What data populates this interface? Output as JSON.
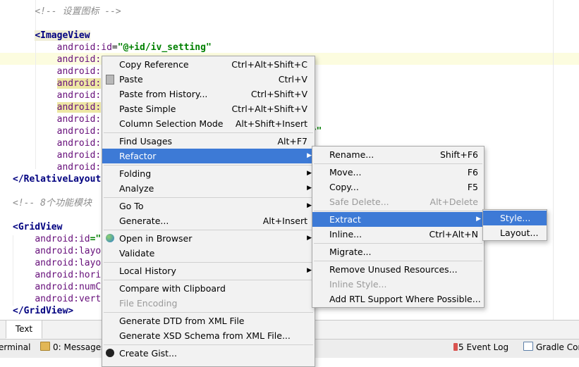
{
  "editor": {
    "lines": [
      {
        "indent": "    ",
        "parts": [
          {
            "t": "<!-- 设置图标 -->",
            "c": "c-comment"
          }
        ]
      },
      {
        "indent": "",
        "parts": []
      },
      {
        "indent": "    ",
        "parts": [
          {
            "t": "<",
            "c": "c-tag-hl"
          },
          {
            "t": "ImageView",
            "c": "c-tag-hl"
          }
        ]
      },
      {
        "indent": "        ",
        "parts": [
          {
            "t": "android:",
            "c": "c-attr"
          },
          {
            "t": "id",
            "c": "c-attr"
          },
          {
            "t": "=",
            "c": "c-punc"
          },
          {
            "t": "\"@+id/iv_setting\"",
            "c": "c-val"
          }
        ]
      },
      {
        "indent": "        ",
        "parts": [
          {
            "t": "android:",
            "c": "c-attr"
          }
        ]
      },
      {
        "indent": "        ",
        "parts": [
          {
            "t": "android:",
            "c": "c-attr"
          }
        ]
      },
      {
        "indent": "        ",
        "parts": [
          {
            "t": "android:",
            "c": "c-attr-hl"
          }
        ]
      },
      {
        "indent": "        ",
        "parts": [
          {
            "t": "android:",
            "c": "c-attr"
          }
        ]
      },
      {
        "indent": "        ",
        "parts": [
          {
            "t": "android:",
            "c": "c-attr-hl"
          }
        ]
      },
      {
        "indent": "        ",
        "parts": [
          {
            "t": "android:",
            "c": "c-attr"
          }
        ]
      },
      {
        "indent": "        ",
        "parts": [
          {
            "t": "android:",
            "c": "c-attr"
          },
          {
            "t": "                                  ector\"",
            "c": "c-val"
          }
        ]
      },
      {
        "indent": "        ",
        "parts": [
          {
            "t": "android:",
            "c": "c-attr"
          }
        ]
      },
      {
        "indent": "        ",
        "parts": [
          {
            "t": "android:",
            "c": "c-attr"
          }
        ]
      },
      {
        "indent": "        ",
        "parts": [
          {
            "t": "android:",
            "c": "c-attr"
          }
        ]
      },
      {
        "indent": "",
        "parts": [
          {
            "t": "</",
            "c": "c-tag"
          },
          {
            "t": "RelativeLayout",
            "c": "c-tag"
          }
        ]
      },
      {
        "indent": "",
        "parts": []
      },
      {
        "indent": "",
        "parts": [
          {
            "t": "<!-- 8个功能模块",
            "c": "c-comment"
          }
        ]
      },
      {
        "indent": "",
        "parts": []
      },
      {
        "indent": "",
        "parts": [
          {
            "t": "<",
            "c": "c-tag"
          },
          {
            "t": "GridView",
            "c": "c-tag"
          }
        ]
      },
      {
        "indent": "    ",
        "parts": [
          {
            "t": "android:",
            "c": "c-attr"
          },
          {
            "t": "id",
            "c": "c-attr"
          },
          {
            "t": "=\"",
            "c": "c-val"
          }
        ]
      },
      {
        "indent": "    ",
        "parts": [
          {
            "t": "android:",
            "c": "c-attr"
          },
          {
            "t": "layo",
            "c": "c-attr"
          }
        ]
      },
      {
        "indent": "    ",
        "parts": [
          {
            "t": "android:",
            "c": "c-attr"
          },
          {
            "t": "layo",
            "c": "c-attr"
          }
        ]
      },
      {
        "indent": "    ",
        "parts": [
          {
            "t": "android:",
            "c": "c-attr"
          },
          {
            "t": "hori",
            "c": "c-attr"
          }
        ]
      },
      {
        "indent": "    ",
        "parts": [
          {
            "t": "android:",
            "c": "c-attr"
          },
          {
            "t": "numC",
            "c": "c-attr"
          }
        ]
      },
      {
        "indent": "    ",
        "parts": [
          {
            "t": "android:",
            "c": "c-attr"
          },
          {
            "t": "vert",
            "c": "c-attr"
          }
        ]
      },
      {
        "indent": "",
        "parts": [
          {
            "t": "</",
            "c": "c-tag"
          },
          {
            "t": "GridView",
            "c": "c-tag"
          },
          {
            "t": ">",
            "c": "c-tag"
          }
        ]
      }
    ]
  },
  "bottom_tabs": {
    "design": "",
    "text": "Text"
  },
  "status_bar": {
    "terminal": "erminal",
    "messages": "0: Messages",
    "event_log_count": "5",
    "event_log": "Event Log",
    "gradle_console": "Gradle Cons"
  },
  "context_menu": {
    "items": [
      {
        "label": "Copy Reference",
        "shortcut": "Ctrl+Alt+Shift+C"
      },
      {
        "label": "Paste",
        "shortcut": "Ctrl+V",
        "icon": "clipboard-paste-icon"
      },
      {
        "label": "Paste from History...",
        "shortcut": "Ctrl+Shift+V"
      },
      {
        "label": "Paste Simple",
        "shortcut": "Ctrl+Alt+Shift+V"
      },
      {
        "label": "Column Selection Mode",
        "shortcut": "Alt+Shift+Insert"
      },
      {
        "sep": true
      },
      {
        "label": "Find Usages",
        "shortcut": "Alt+F7"
      },
      {
        "label": "Refactor",
        "submenu": true,
        "selected": true
      },
      {
        "sep": true
      },
      {
        "label": "Folding",
        "submenu": true
      },
      {
        "label": "Analyze",
        "submenu": true
      },
      {
        "sep": true
      },
      {
        "label": "Go To",
        "submenu": true
      },
      {
        "label": "Generate...",
        "shortcut": "Alt+Insert"
      },
      {
        "sep": true
      },
      {
        "label": "Open in Browser",
        "submenu": true,
        "icon": "globe-icon"
      },
      {
        "label": "Validate"
      },
      {
        "sep": true
      },
      {
        "label": "Local History",
        "submenu": true
      },
      {
        "sep": true
      },
      {
        "label": "Compare with Clipboard"
      },
      {
        "label": "File Encoding",
        "disabled": true
      },
      {
        "sep": true
      },
      {
        "label": "Generate DTD from XML File"
      },
      {
        "label": "Generate XSD Schema from XML File..."
      },
      {
        "sep": true
      },
      {
        "label": "Create Gist...",
        "icon": "github-icon"
      }
    ]
  },
  "refactor_menu": {
    "items": [
      {
        "label": "Rename...",
        "shortcut": "Shift+F6"
      },
      {
        "sep": true
      },
      {
        "label": "Move...",
        "shortcut": "F6"
      },
      {
        "label": "Copy...",
        "shortcut": "F5"
      },
      {
        "label": "Safe Delete...",
        "shortcut": "Alt+Delete",
        "disabled": true
      },
      {
        "sep": true
      },
      {
        "label": "Extract",
        "submenu": true,
        "selected": true
      },
      {
        "label": "Inline...",
        "shortcut": "Ctrl+Alt+N"
      },
      {
        "sep": true
      },
      {
        "label": "Migrate..."
      },
      {
        "sep": true
      },
      {
        "label": "Remove Unused Resources..."
      },
      {
        "label": "Inline Style...",
        "disabled": true
      },
      {
        "label": "Add RTL Support Where Possible..."
      }
    ]
  },
  "extract_menu": {
    "items": [
      {
        "label": "Style...",
        "selected": true
      },
      {
        "label": "Layout..."
      }
    ]
  },
  "colors": {
    "selection": "#3d7ad6",
    "menu_bg": "#f2f2f2",
    "xml_tag": "#000080",
    "xml_attr": "#660e7a",
    "xml_value": "#008000",
    "comment": "#8c8c8c"
  }
}
